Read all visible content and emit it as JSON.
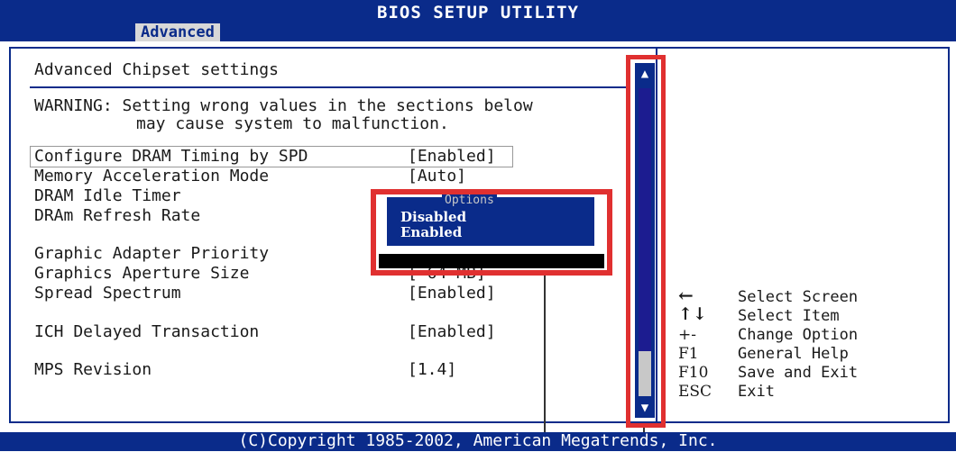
{
  "header": {
    "title": "BIOS SETUP UTILITY",
    "active_tab": "Advanced"
  },
  "panel": {
    "heading": "Advanced Chipset settings",
    "warning_line1": "WARNING: Setting wrong values in the sections below",
    "warning_line2": "may cause system to malfunction."
  },
  "settings": [
    {
      "label": "Configure DRAM Timing by SPD",
      "value": "[Enabled]"
    },
    {
      "label": "Memory Acceleration Mode",
      "value": "[Auto]"
    },
    {
      "label": "DRAM Idle Timer",
      "value": ""
    },
    {
      "label": "DRAm Refresh Rate",
      "value": ""
    },
    {
      "label": "Graphic Adapter Priority",
      "value": ""
    },
    {
      "label": "Graphics Aperture Size",
      "value": "[ 64 MB]"
    },
    {
      "label": "Spread Spectrum",
      "value": "[Enabled]"
    },
    {
      "label": "ICH Delayed Transaction",
      "value": "[Enabled]"
    },
    {
      "label": "MPS Revision",
      "value": "[1.4]"
    }
  ],
  "options_popup": {
    "title": "Options",
    "items": [
      "Disabled",
      "Enabled"
    ]
  },
  "help": [
    {
      "key": "←",
      "desc": "Select Screen"
    },
    {
      "key": "↑↓",
      "desc": "Select Item"
    },
    {
      "key": "+-",
      "desc": "Change Option"
    },
    {
      "key": "F1",
      "desc": "General Help"
    },
    {
      "key": "F10",
      "desc": "Save and Exit"
    },
    {
      "key": "ESC",
      "desc": "Exit"
    }
  ],
  "scrollbar": {
    "up_icon": "▲",
    "down_icon": "▼"
  },
  "footer": {
    "copyright": "(C)Copyright 1985-2002, American Megatrends, Inc."
  },
  "colors": {
    "bios_blue": "#0a2b8a",
    "highlight_red": "#e03030"
  }
}
